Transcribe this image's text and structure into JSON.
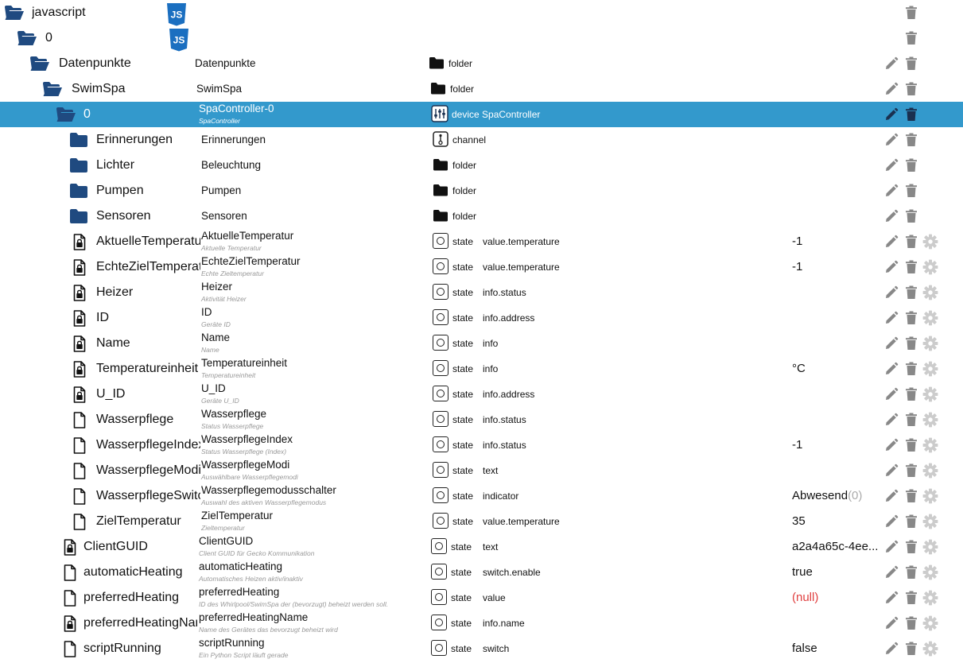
{
  "colors": {
    "selection": "#3399cc",
    "folder": "#1f4a80",
    "icon_gray": "#888888",
    "null_value": "#e04040",
    "js_badge": "#1b6fc0"
  },
  "tree": [
    {
      "id": "javascript",
      "level": 0,
      "icon": "folder-open-icon",
      "badge": "JS",
      "deletable": true
    },
    {
      "id": "0",
      "level": 1,
      "icon": "folder-open-icon",
      "badge": "JS",
      "deletable": true
    },
    {
      "id": "Datenpunkte",
      "level": 2,
      "icon": "folder-open-icon",
      "name": "Datenpunkte",
      "type_icon": "folder-icon",
      "type": "folder",
      "editable": true,
      "deletable": true
    },
    {
      "id": "SwimSpa",
      "level": 3,
      "icon": "folder-open-icon",
      "name": "SwimSpa",
      "type_icon": "folder-icon",
      "type": "folder",
      "editable": true,
      "deletable": true
    },
    {
      "id": "0",
      "level": 4,
      "icon": "folder-open-icon",
      "name": "SpaController-0",
      "desc": "SpaController",
      "type_icon": "device-icon",
      "type": "device SpaController",
      "editable": true,
      "deletable": true,
      "selected": true
    },
    {
      "id": "Erinnerungen",
      "level": 5,
      "icon": "folder-icon",
      "name": "Erinnerungen",
      "type_icon": "channel-icon",
      "type": "channel",
      "editable": true,
      "deletable": true
    },
    {
      "id": "Lichter",
      "level": 5,
      "icon": "folder-icon",
      "name": "Beleuchtung",
      "type_icon": "folder-icon",
      "type": "folder",
      "editable": true,
      "deletable": true
    },
    {
      "id": "Pumpen",
      "level": 5,
      "icon": "folder-icon",
      "name": "Pumpen",
      "type_icon": "folder-icon",
      "type": "folder",
      "editable": true,
      "deletable": true
    },
    {
      "id": "Sensoren",
      "level": 5,
      "icon": "folder-icon",
      "name": "Sensoren",
      "type_icon": "folder-icon",
      "type": "folder",
      "editable": true,
      "deletable": true
    },
    {
      "id": "AktuelleTemperatur",
      "level": 5,
      "icon": "file-lock-icon",
      "name": "AktuelleTemperatur",
      "desc": "Aktuelle Temperatur",
      "type_icon": "state-icon",
      "type": "state",
      "role": "value.temperature",
      "value": "-1",
      "editable": true,
      "deletable": true,
      "settings": true
    },
    {
      "id": "EchteZielTemperatur",
      "level": 5,
      "icon": "file-lock-icon",
      "name": "EchteZielTemperatur",
      "desc": "Echte Zieltemperatur",
      "type_icon": "state-icon",
      "type": "state",
      "role": "value.temperature",
      "value": "-1",
      "editable": true,
      "deletable": true,
      "settings": true
    },
    {
      "id": "Heizer",
      "level": 5,
      "icon": "file-lock-icon",
      "name": "Heizer",
      "desc": "Aktivität Heizer",
      "type_icon": "state-icon",
      "type": "state",
      "role": "info.status",
      "editable": true,
      "deletable": true,
      "settings": true
    },
    {
      "id": "ID",
      "level": 5,
      "icon": "file-lock-icon",
      "name": "ID",
      "desc": "Geräte ID",
      "type_icon": "state-icon",
      "type": "state",
      "role": "info.address",
      "editable": true,
      "deletable": true,
      "settings": true
    },
    {
      "id": "Name",
      "level": 5,
      "icon": "file-lock-icon",
      "name": "Name",
      "desc": "Name",
      "type_icon": "state-icon",
      "type": "state",
      "role": "info",
      "editable": true,
      "deletable": true,
      "settings": true
    },
    {
      "id": "Temperatureinheit",
      "level": 5,
      "icon": "file-lock-icon",
      "name": "Temperatureinheit",
      "desc": "Temperatureinheit",
      "type_icon": "state-icon",
      "type": "state",
      "role": "info",
      "value": "°C",
      "editable": true,
      "deletable": true,
      "settings": true
    },
    {
      "id": "U_ID",
      "level": 5,
      "icon": "file-lock-icon",
      "name": "U_ID",
      "desc": "Geräte U_ID",
      "type_icon": "state-icon",
      "type": "state",
      "role": "info.address",
      "editable": true,
      "deletable": true,
      "settings": true
    },
    {
      "id": "Wasserpflege",
      "level": 5,
      "icon": "file-icon",
      "name": "Wasserpflege",
      "desc": "Status Wasserpflege",
      "type_icon": "state-icon",
      "type": "state",
      "role": "info.status",
      "editable": true,
      "deletable": true,
      "settings": true
    },
    {
      "id": "WasserpflegeIndex",
      "level": 5,
      "icon": "file-icon",
      "name": "WasserpflegeIndex",
      "desc": "Status Wasserpflege (Index)",
      "type_icon": "state-icon",
      "type": "state",
      "role": "info.status",
      "value": "-1",
      "editable": true,
      "deletable": true,
      "settings": true
    },
    {
      "id": "WasserpflegeModi",
      "level": 5,
      "icon": "file-icon",
      "name": "WasserpflegeModi",
      "desc": "Auswählbare Wasserpflegemodi",
      "type_icon": "state-icon",
      "type": "state",
      "role": "text",
      "editable": true,
      "deletable": true,
      "settings": true
    },
    {
      "id": "WasserpflegeSwitch",
      "level": 5,
      "icon": "file-icon",
      "name": "Wasserpflegemodusschalter",
      "desc": "Auswahl des aktiven Wasserpflegemodus",
      "type_icon": "state-icon",
      "type": "state",
      "role": "indicator",
      "value": "Abwesend",
      "value_suffix": "(0)",
      "editable": true,
      "deletable": true,
      "settings": true
    },
    {
      "id": "ZielTemperatur",
      "level": 5,
      "icon": "file-icon",
      "name": "ZielTemperatur",
      "desc": "Zieltemperatur",
      "type_icon": "state-icon",
      "type": "state",
      "role": "value.temperature",
      "value": "35",
      "editable": true,
      "deletable": true,
      "settings": true
    },
    {
      "id": "ClientGUID",
      "level": 4,
      "icon": "file-lock-icon",
      "name": "ClientGUID",
      "desc": "Client GUID für Gecko Kommunikation",
      "type_icon": "state-icon",
      "type": "state",
      "role": "text",
      "value": "a2a4a65c-4ee...",
      "editable": true,
      "deletable": true,
      "settings": true
    },
    {
      "id": "automaticHeating",
      "level": 4,
      "icon": "file-icon",
      "name": "automaticHeating",
      "desc": "Automatisches Heizen aktiv/inaktiv",
      "type_icon": "state-icon",
      "type": "state",
      "role": "switch.enable",
      "value": "true",
      "editable": true,
      "deletable": true,
      "settings": true
    },
    {
      "id": "preferredHeating",
      "level": 4,
      "icon": "file-icon",
      "name": "preferredHeating",
      "desc": "ID des Whirlpool/SwimSpa der (bevorzugt) beheizt werden soll.",
      "type_icon": "state-icon",
      "type": "state",
      "role": "value",
      "value": "(null)",
      "value_null": true,
      "editable": true,
      "deletable": true,
      "settings": true
    },
    {
      "id": "preferredHeatingName",
      "level": 4,
      "icon": "file-lock-icon",
      "name": "preferredHeatingName",
      "desc": "Name des Gerätes das bevorzugt beheizt wird",
      "type_icon": "state-icon",
      "type": "state",
      "role": "info.name",
      "editable": true,
      "deletable": true,
      "settings": true
    },
    {
      "id": "scriptRunning",
      "level": 4,
      "icon": "file-icon",
      "name": "scriptRunning",
      "desc": "Ein Python Script läuft gerade",
      "type_icon": "state-icon",
      "type": "state",
      "role": "switch",
      "value": "false",
      "editable": true,
      "deletable": true,
      "settings": true
    }
  ]
}
